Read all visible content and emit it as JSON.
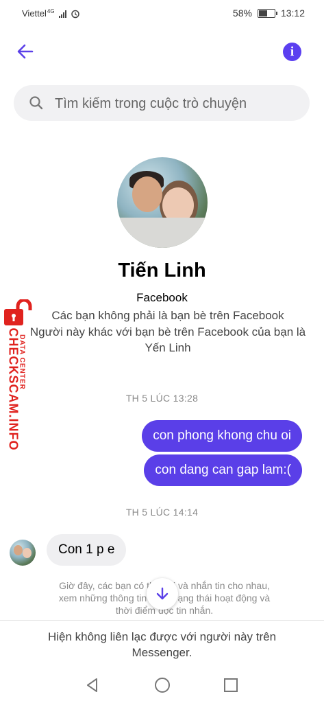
{
  "status_bar": {
    "carrier": "Viettel",
    "network": "4G",
    "battery_percent": "58%",
    "battery_level": 0.58,
    "time": "13:12"
  },
  "header": {
    "back_icon": "arrow-left-icon",
    "info_icon": "info-icon",
    "accent_color": "#5a3fe8"
  },
  "search": {
    "placeholder": "Tìm kiếm trong cuộc trò chuyện"
  },
  "profile": {
    "name": "Tiến Linh",
    "platform": "Facebook",
    "note_1": "Các bạn không phải là bạn bè trên Facebook",
    "note_2": "Người này khác với bạn bè trên Facebook của bạn là Yến Linh"
  },
  "watermark": {
    "brand": "CHECKSCAM.INFO",
    "sub": "DATA CENTER",
    "color": "#e0231f"
  },
  "conversation": {
    "timestamp_1": "TH 5 LÚC 13:28",
    "out_1": "con phong khong chu oi",
    "out_2": "con dang can gap lam:(",
    "timestamp_2": "TH 5 LÚC 14:14",
    "in_1": "Con 1 p e",
    "system_notice": "Giờ đây, các bạn có thể gọi và nhắn tin cho nhau, xem những thông tin như Trạng thái hoạt động và thời điểm đọc tin nhắn."
  },
  "footer": {
    "unavailable": "Hiện không liên lạc được với người này trên Messenger."
  },
  "nav_bar": {
    "back": "triangle-back-icon",
    "home": "circle-home-icon",
    "recents": "square-recents-icon"
  }
}
